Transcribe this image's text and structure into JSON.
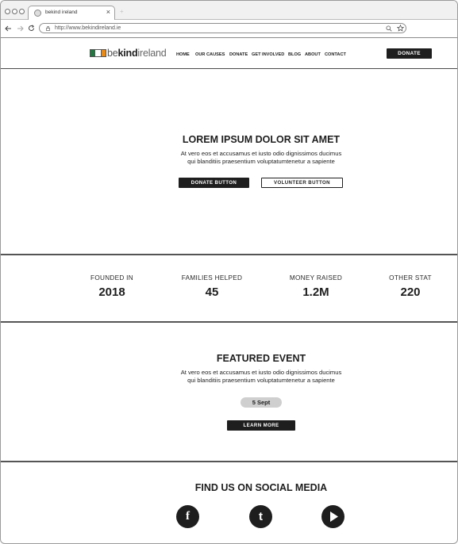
{
  "browser": {
    "tab_title": "bekind ireland",
    "tab_close": "×",
    "new_tab": "+",
    "url": "http://www.bekindireland.ie"
  },
  "header": {
    "logo": {
      "part1": "be",
      "part2": "kind",
      "part3": "ireland"
    },
    "flag_colors": [
      "#1f7a3f",
      "#ffffff",
      "#e88a1a"
    ],
    "nav": [
      "HOME",
      "OUR CAUSES",
      "DONATE",
      "GET INVOLVED",
      "BLOG",
      "ABOUT",
      "CONTACT"
    ],
    "donate_label": "DONATE"
  },
  "hero": {
    "title": "LOREM IPSUM DOLOR SIT AMET",
    "line1": "At vero eos et accusamus et iusto odio dignissimos ducimus",
    "line2": "qui blanditiis praesentium voluptatumtenetur a sapiente",
    "donate_button": "DONATE BUTTON",
    "volunteer_button": "VOLUNTEER BUTTON"
  },
  "stats": [
    {
      "label": "FOUNDED IN",
      "value": "2018"
    },
    {
      "label": "FAMILIES HELPED",
      "value": "45"
    },
    {
      "label": "MONEY RAISED",
      "value": "1.2M"
    },
    {
      "label": "OTHER STAT",
      "value": "220"
    }
  ],
  "event": {
    "title": "FEATURED EVENT",
    "line1": "At vero eos et accusamus et iusto odio dignissimos ducimus",
    "line2": "qui blanditiis praesentium voluptatumtenetur a sapiente",
    "date": "5 Sept",
    "learn_more": "LEARN MORE"
  },
  "social": {
    "title": "FIND US ON SOCIAL MEDIA",
    "facebook": "f",
    "tumblr": "t"
  }
}
